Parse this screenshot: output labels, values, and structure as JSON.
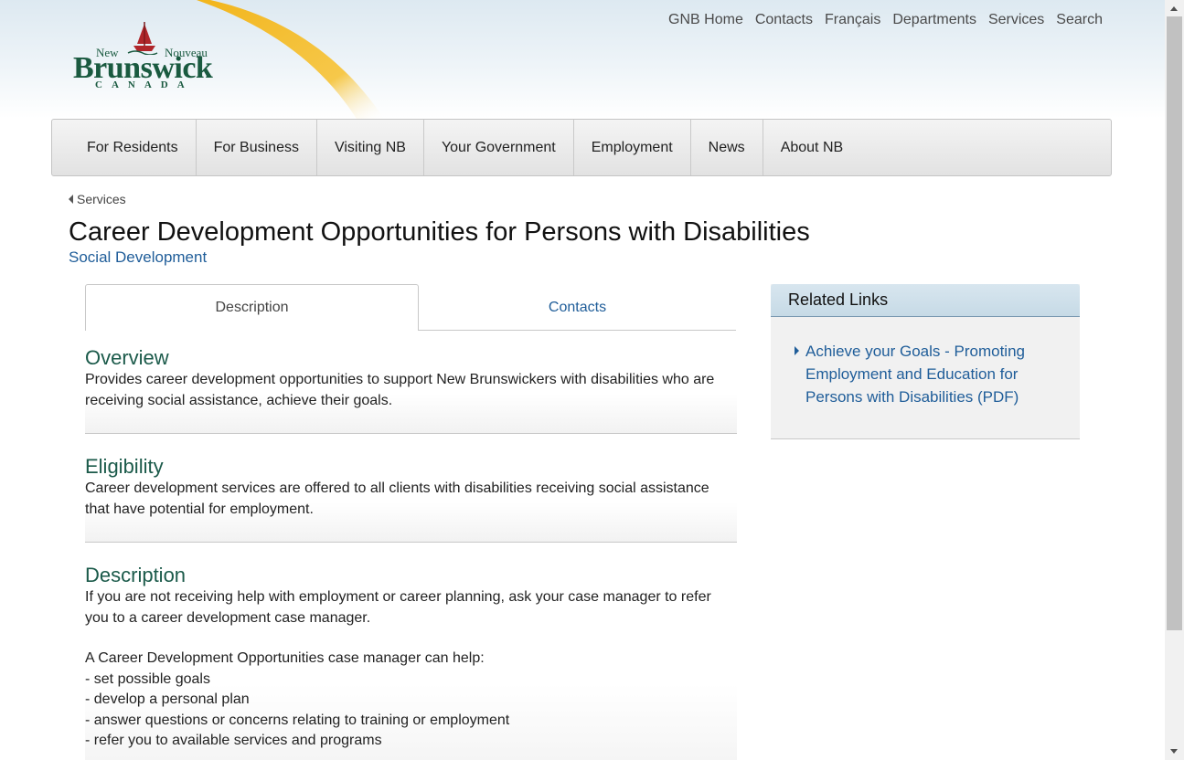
{
  "header": {
    "logo": {
      "new": "New",
      "nouveau": "Nouveau",
      "brunswick": "Brunswick",
      "canada": "CANADA"
    },
    "utility_nav": [
      "GNB Home",
      "Contacts",
      "Français",
      "Departments",
      "Services",
      "Search"
    ]
  },
  "main_nav": [
    "For Residents",
    "For Business",
    "Visiting NB",
    "Your Government",
    "Employment",
    "News",
    "About NB"
  ],
  "breadcrumb": {
    "label": "Services"
  },
  "page": {
    "title": "Career Development Opportunities for Persons with Disabilities",
    "department": "Social Development"
  },
  "tabs": {
    "description": "Description",
    "contacts": "Contacts",
    "active": "Description"
  },
  "sections": {
    "overview": {
      "heading": "Overview",
      "text": "Provides career development opportunities to support New Brunswickers with disabilities who are receiving social assistance, achieve their goals."
    },
    "eligibility": {
      "heading": "Eligibility",
      "text": "Career development services are offered to all clients with disabilities receiving social assistance that have potential for employment."
    },
    "description": {
      "heading": "Description",
      "para1": "If you are not receiving help with employment or career planning, ask your case manager to refer you to a career development case manager.",
      "list_intro": "A Career Development Opportunities case manager can help:",
      "items": [
        "- set possible goals",
        "- develop a personal plan",
        "- answer questions or concerns relating to training or employment",
        "- refer you to available services and programs"
      ]
    }
  },
  "related_links": {
    "heading": "Related Links",
    "items": [
      "Achieve your Goals - Promoting Employment and Education for Persons with Disabilities (PDF)"
    ]
  },
  "colors": {
    "link": "#1f5d99",
    "heading_green": "#1b5a4a",
    "logo_green": "#1a5a40",
    "swoosh_yellow": "#f2b51c"
  }
}
